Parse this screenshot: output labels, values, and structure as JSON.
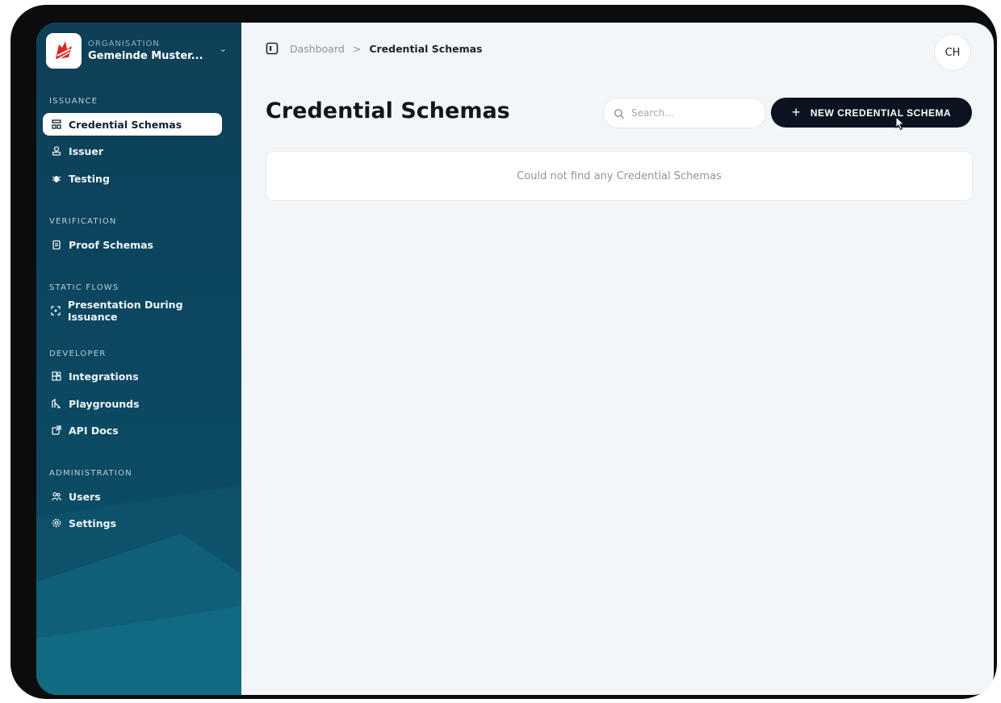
{
  "sidebar": {
    "org_caption": "ORGANISATION",
    "org_name": "Gemeinde Muster...",
    "sections": {
      "issuance": "ISSUANCE",
      "verification": "VERIFICATION",
      "static_flows": "STATIC FLOWS",
      "developer": "DEVELOPER",
      "administration": "ADMINISTRATION"
    },
    "items": {
      "credential_schemas": "Credential Schemas",
      "issuer": "Issuer",
      "testing": "Testing",
      "proof_schemas": "Proof Schemas",
      "presentation_during_issuance": "Presentation During Issuance",
      "integrations": "Integrations",
      "playgrounds": "Playgrounds",
      "api_docs": "API Docs",
      "users": "Users",
      "settings": "Settings"
    }
  },
  "breadcrumb": {
    "home": "Dashboard",
    "separator": ">",
    "current": "Credential Schemas"
  },
  "avatar_initials": "CH",
  "page_title": "Credential Schemas",
  "search": {
    "placeholder": "Search..."
  },
  "new_button": {
    "plus": "+",
    "label": "NEW CREDENTIAL SCHEMA"
  },
  "empty_state": "Could not find any Credential Schemas",
  "colors": {
    "sidebar": "#0e3f57",
    "active_item": "#ffffff",
    "primary_button": "#0b1320",
    "main_bg": "#f3f6f8"
  }
}
